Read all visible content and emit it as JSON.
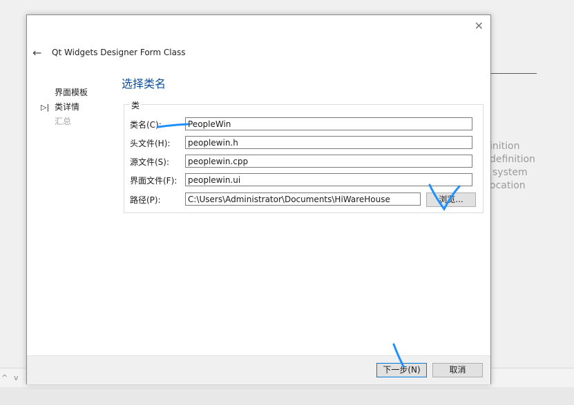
{
  "background_window": {
    "text_lines": [
      "inition",
      "definition",
      "system",
      "ocation"
    ]
  },
  "dialog": {
    "title": "Qt Widgets Designer Form Class",
    "close_icon": "close-icon",
    "back_icon": "back-arrow-icon"
  },
  "nav": {
    "items": [
      {
        "label": "界面模板",
        "state": "done"
      },
      {
        "label": "类详情",
        "state": "current"
      },
      {
        "label": "汇总",
        "state": "pending"
      }
    ],
    "current_marker": "▷|"
  },
  "page_title": "选择类名",
  "group": {
    "label": "类",
    "fields": {
      "class_name": {
        "label": "类名(C):",
        "value": "PeopleWin"
      },
      "header_file": {
        "label": "头文件(H):",
        "value": "peoplewin.h"
      },
      "source_file": {
        "label": "源文件(S):",
        "value": "peoplewin.cpp"
      },
      "form_file": {
        "label": "界面文件(F):",
        "value": "peoplewin.ui"
      },
      "path": {
        "label": "路径(P):",
        "value": "C:\\Users\\Administrator\\Documents\\HiWareHouse"
      }
    },
    "browse_label": "浏览..."
  },
  "footer": {
    "next_label": "下一步(N)",
    "cancel_label": "取消"
  },
  "colors": {
    "accent": "#0b4f9c",
    "annotation": "#1e90ff"
  }
}
